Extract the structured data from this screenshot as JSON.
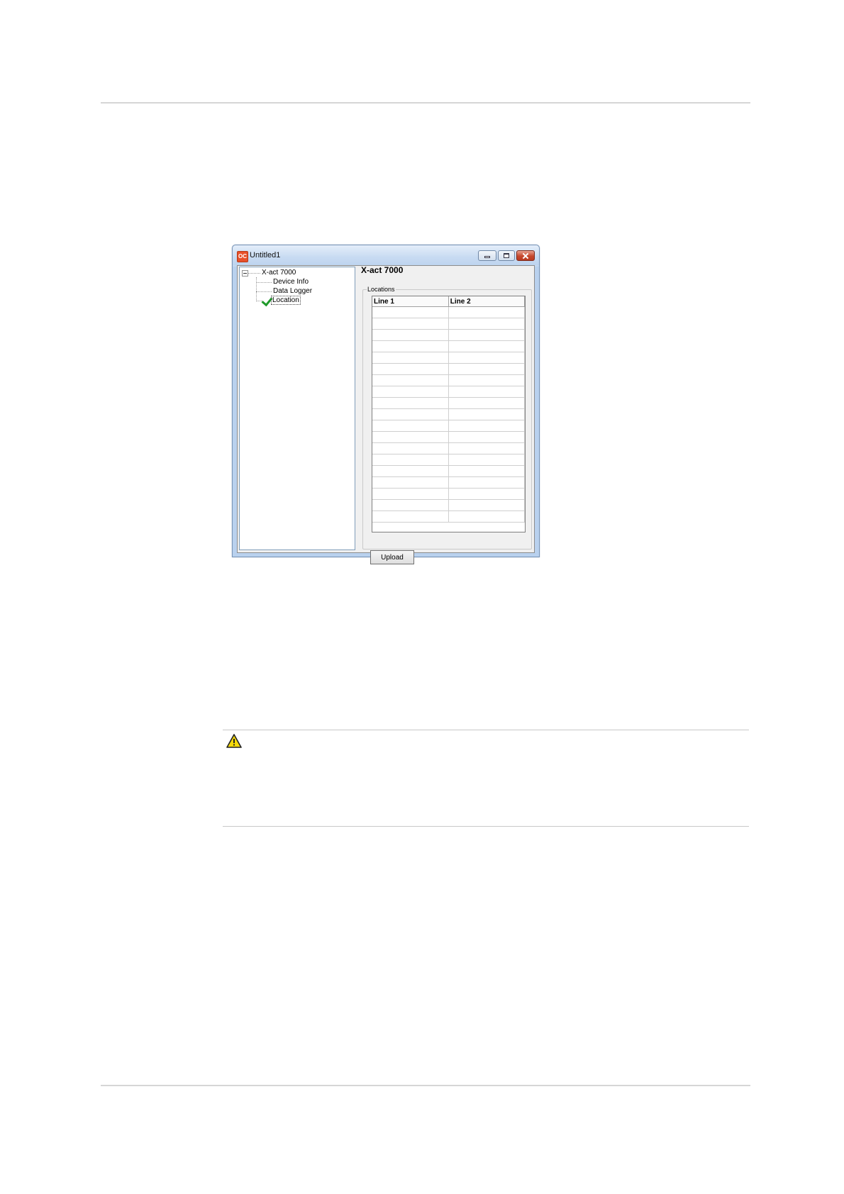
{
  "window": {
    "title": "Untitled1",
    "app_icon_text": "OC"
  },
  "tree": {
    "root": "X-act 7000",
    "items": [
      "Device Info",
      "Data Logger",
      "Location"
    ],
    "selected": "Location"
  },
  "panel": {
    "device_title": "X-act 7000",
    "group_label": "Locations",
    "columns": [
      "Line 1",
      "Line 2"
    ],
    "empty_rows": 19,
    "upload_label": "Upload"
  },
  "icons": {
    "check": "check-icon",
    "warning": "warning-icon"
  },
  "colors": {
    "check": "#1f9a2a",
    "warning": "#f5d90a"
  }
}
